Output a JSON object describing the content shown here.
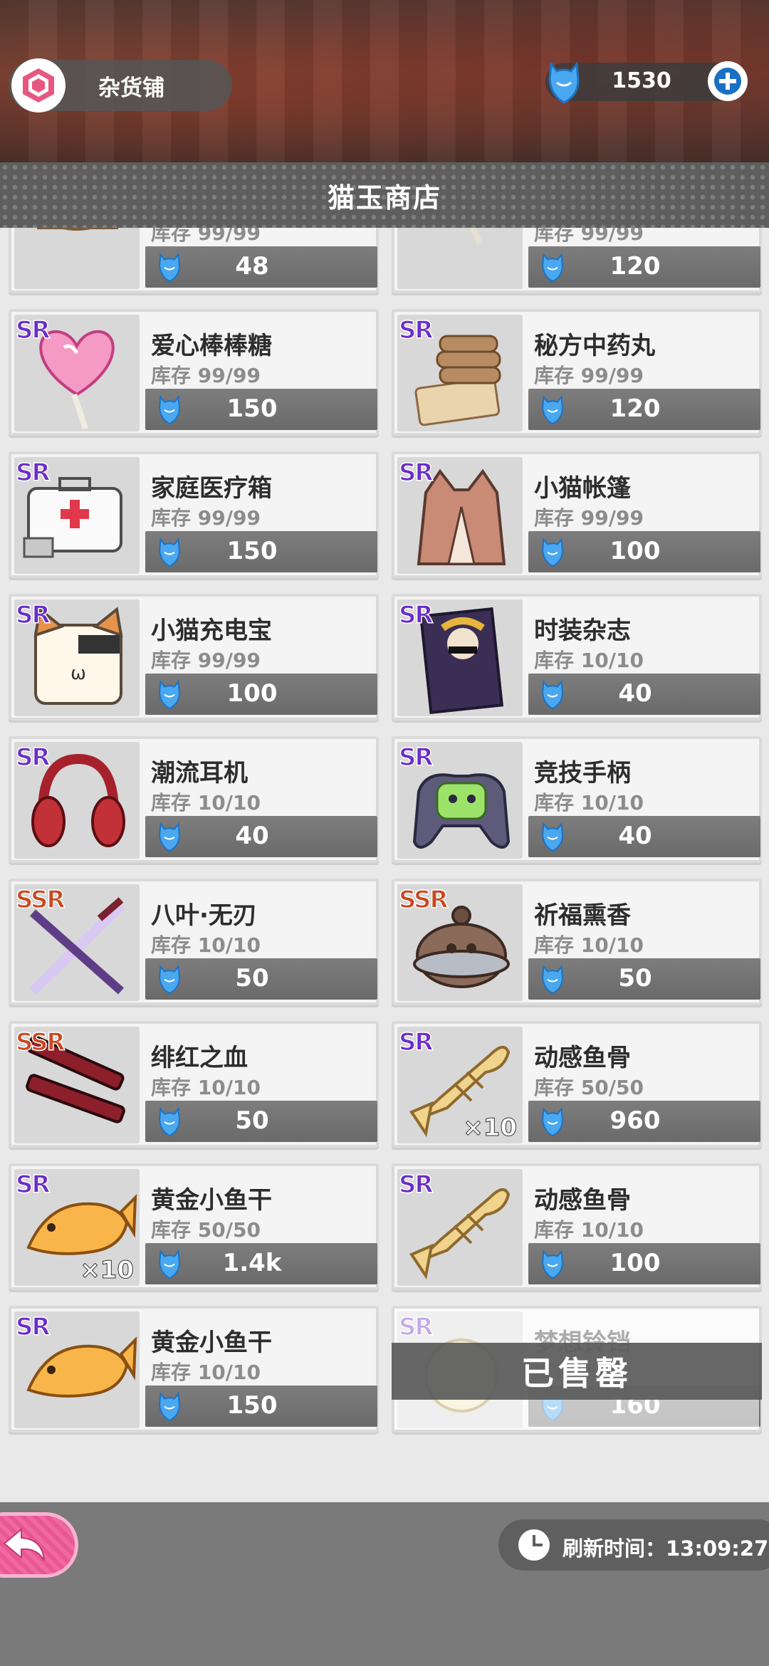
{
  "header": {
    "shop_name": "杂货铺",
    "currency_value": "1530"
  },
  "title": "猫玉商店",
  "stock_prefix": "库存",
  "items": [
    {
      "rarity": "",
      "name": "",
      "stock": "99/99",
      "price": "48",
      "icon": "cat-box-icon",
      "partial": true
    },
    {
      "rarity": "",
      "name": "",
      "stock": "99/99",
      "price": "120",
      "icon": "lollipop-icon",
      "partial": true
    },
    {
      "rarity": "SR",
      "name": "爱心棒棒糖",
      "stock": "99/99",
      "price": "150",
      "icon": "heart-lollipop-icon"
    },
    {
      "rarity": "SR",
      "name": "秘方中药丸",
      "stock": "99/99",
      "price": "120",
      "icon": "herbal-pills-icon"
    },
    {
      "rarity": "SR",
      "name": "家庭医疗箱",
      "stock": "99/99",
      "price": "150",
      "icon": "medical-kit-icon"
    },
    {
      "rarity": "SR",
      "name": "小猫帐篷",
      "stock": "99/99",
      "price": "100",
      "icon": "cat-tent-icon"
    },
    {
      "rarity": "SR",
      "name": "小猫充电宝",
      "stock": "99/99",
      "price": "100",
      "icon": "cat-powerbank-icon"
    },
    {
      "rarity": "SR",
      "name": "时装杂志",
      "stock": "10/10",
      "price": "40",
      "icon": "fashion-magazine-icon"
    },
    {
      "rarity": "SR",
      "name": "潮流耳机",
      "stock": "10/10",
      "price": "40",
      "icon": "headphones-icon"
    },
    {
      "rarity": "SR",
      "name": "竞技手柄",
      "stock": "10/10",
      "price": "40",
      "icon": "gamepad-icon"
    },
    {
      "rarity": "SSR",
      "name": "八叶·无刃",
      "stock": "10/10",
      "price": "50",
      "icon": "sword-icon"
    },
    {
      "rarity": "SSR",
      "name": "祈福熏香",
      "stock": "10/10",
      "price": "50",
      "icon": "incense-burner-icon"
    },
    {
      "rarity": "SSR",
      "name": "绯红之血",
      "stock": "10/10",
      "price": "50",
      "icon": "twin-guns-icon"
    },
    {
      "rarity": "SR",
      "name": "动感鱼骨",
      "stock": "50/50",
      "price": "960",
      "icon": "fish-bone-icon",
      "qty": "×10"
    },
    {
      "rarity": "SR",
      "name": "黄金小鱼干",
      "stock": "50/50",
      "price": "1.4k",
      "icon": "golden-fish-icon",
      "qty": "×10"
    },
    {
      "rarity": "SR",
      "name": "动感鱼骨",
      "stock": "10/10",
      "price": "100",
      "icon": "fish-bone-icon"
    },
    {
      "rarity": "SR",
      "name": "黄金小鱼干",
      "stock": "10/10",
      "price": "150",
      "icon": "golden-fish-icon"
    },
    {
      "rarity": "SR",
      "name": "梦想铃铛",
      "stock": "",
      "price": "160",
      "icon": "bell-icon",
      "sold_out": true
    }
  ],
  "sold_out_label": "已售罄",
  "footer": {
    "refresh_label": "刷新时间：13:09:27"
  }
}
